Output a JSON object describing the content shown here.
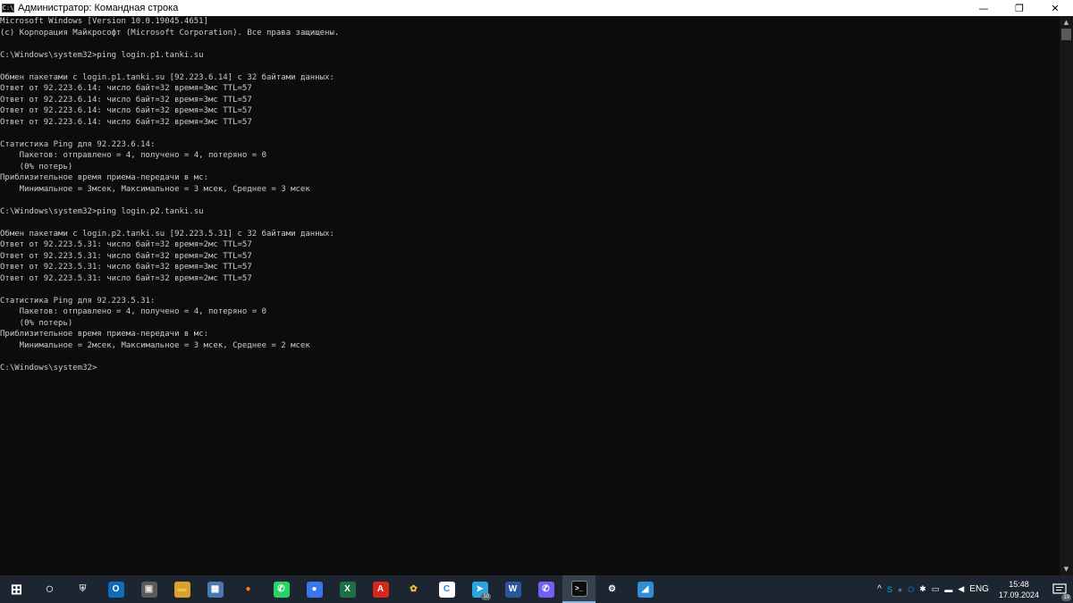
{
  "window": {
    "title": "Администратор: Командная строка",
    "icon_text": "C:\\",
    "minimize_glyph": "—",
    "maximize_glyph": "❐",
    "close_glyph": "✕"
  },
  "console": {
    "lines": [
      "Microsoft Windows [Version 10.0.19045.4651]",
      "(c) Корпорация Майкрософт (Microsoft Corporation). Все права защищены.",
      "",
      "C:\\Windows\\system32>ping login.p1.tanki.su",
      "",
      "Обмен пакетами с login.p1.tanki.su [92.223.6.14] с 32 байтами данных:",
      "Ответ от 92.223.6.14: число байт=32 время=3мс TTL=57",
      "Ответ от 92.223.6.14: число байт=32 время=3мс TTL=57",
      "Ответ от 92.223.6.14: число байт=32 время=3мс TTL=57",
      "Ответ от 92.223.6.14: число байт=32 время=3мс TTL=57",
      "",
      "Статистика Ping для 92.223.6.14:",
      "    Пакетов: отправлено = 4, получено = 4, потеряно = 0",
      "    (0% потерь)",
      "Приблизительное время приема-передачи в мс:",
      "    Минимальное = 3мсек, Максимальное = 3 мсек, Среднее = 3 мсек",
      "",
      "C:\\Windows\\system32>ping login.p2.tanki.su",
      "",
      "Обмен пакетами с login.p2.tanki.su [92.223.5.31] с 32 байтами данных:",
      "Ответ от 92.223.5.31: число байт=32 время=2мс TTL=57",
      "Ответ от 92.223.5.31: число байт=32 время=2мс TTL=57",
      "Ответ от 92.223.5.31: число байт=32 время=3мс TTL=57",
      "Ответ от 92.223.5.31: число байт=32 время=2мс TTL=57",
      "",
      "Статистика Ping для 92.223.5.31:",
      "    Пакетов: отправлено = 4, получено = 4, потеряно = 0",
      "    (0% потерь)",
      "Приблизительное время приема-передачи в мс:",
      "    Минимальное = 2мсек, Максимальное = 3 мсек, Среднее = 2 мсек",
      "",
      "C:\\Windows\\system32>"
    ]
  },
  "scrollbar": {
    "up_glyph": "▲",
    "down_glyph": "▼"
  },
  "taskbar": {
    "apps": [
      {
        "name": "start-button",
        "icon": "windows-icon",
        "glyph": "⊞",
        "color": "#ffffff",
        "bg": "transparent"
      },
      {
        "name": "search-button",
        "icon": "search-icon",
        "glyph": "○",
        "color": "#ffffff",
        "bg": "transparent"
      },
      {
        "name": "taskbar-tanki",
        "icon": "tanki-icon",
        "glyph": "⛨",
        "color": "#d0d0d0",
        "bg": "transparent"
      },
      {
        "name": "taskbar-outlook",
        "icon": "outlook-icon",
        "glyph": "O",
        "color": "#ffffff",
        "bg": "#0f6cbd"
      },
      {
        "name": "taskbar-photo-app",
        "icon": "photo-icon",
        "glyph": "▣",
        "color": "#e8e0d0",
        "bg": "#5a5a5a"
      },
      {
        "name": "taskbar-file-explorer",
        "icon": "folder-icon",
        "glyph": "▬",
        "color": "#f2c14e",
        "bg": "#d9a22a"
      },
      {
        "name": "taskbar-calculator",
        "icon": "calculator-icon",
        "glyph": "▦",
        "color": "#ffffff",
        "bg": "#4a78b5"
      },
      {
        "name": "taskbar-firefox",
        "icon": "firefox-icon",
        "glyph": "●",
        "color": "#ff7a1a",
        "bg": "transparent"
      },
      {
        "name": "taskbar-whatsapp",
        "icon": "whatsapp-icon",
        "glyph": "✆",
        "color": "#ffffff",
        "bg": "#25d366"
      },
      {
        "name": "taskbar-signal",
        "icon": "chat-bubble-icon",
        "glyph": "●",
        "color": "#ffffff",
        "bg": "#3a76f0"
      },
      {
        "name": "taskbar-excel",
        "icon": "excel-icon",
        "glyph": "X",
        "color": "#ffffff",
        "bg": "#1d7044"
      },
      {
        "name": "taskbar-acrobat",
        "icon": "acrobat-icon",
        "glyph": "A",
        "color": "#ffffff",
        "bg": "#d7261b"
      },
      {
        "name": "taskbar-butterfly-app",
        "icon": "butterfly-icon",
        "glyph": "✿",
        "color": "#f5c43c",
        "bg": "transparent"
      },
      {
        "name": "taskbar-cisco-c",
        "icon": "c-logo-icon",
        "glyph": "C",
        "color": "#1e88e5",
        "bg": "#ffffff"
      },
      {
        "name": "taskbar-telegram",
        "icon": "telegram-icon",
        "glyph": "➤",
        "color": "#ffffff",
        "bg": "#2aa3df",
        "badge": "10"
      },
      {
        "name": "taskbar-word",
        "icon": "word-icon",
        "glyph": "W",
        "color": "#ffffff",
        "bg": "#2b579a"
      },
      {
        "name": "taskbar-viber",
        "icon": "viber-icon",
        "glyph": "✆",
        "color": "#ffffff",
        "bg": "#7360f2"
      },
      {
        "name": "taskbar-command-prompt",
        "icon": "terminal-icon",
        "glyph": ">_",
        "color": "#ffffff",
        "bg": "#0c0c0c",
        "active": true
      },
      {
        "name": "taskbar-settings",
        "icon": "gear-icon",
        "glyph": "⚙",
        "color": "#ffffff",
        "bg": "transparent"
      },
      {
        "name": "taskbar-paint-app",
        "icon": "paint-icon",
        "glyph": "◢",
        "color": "#ffffff",
        "bg": "#2e8fd6"
      }
    ],
    "tray": {
      "chevron_glyph": "^",
      "icons": [
        {
          "name": "tray-skype-icon",
          "glyph": "S",
          "color": "#00aff0"
        },
        {
          "name": "tray-teams-icon",
          "glyph": "●",
          "color": "#6264a7"
        },
        {
          "name": "tray-outlook-icon",
          "glyph": "O",
          "color": "#0f6cbd"
        },
        {
          "name": "tray-bluetooth-icon",
          "glyph": "✱",
          "color": "#ffffff"
        },
        {
          "name": "tray-network-icon",
          "glyph": "▭",
          "color": "#ffffff"
        },
        {
          "name": "tray-battery-icon",
          "glyph": "▬",
          "color": "#ffffff"
        },
        {
          "name": "tray-volume-icon",
          "glyph": "◀",
          "color": "#ffffff"
        }
      ],
      "language": "ENG",
      "time": "15:48",
      "date": "17.09.2024",
      "notifications_badge": "19"
    }
  }
}
